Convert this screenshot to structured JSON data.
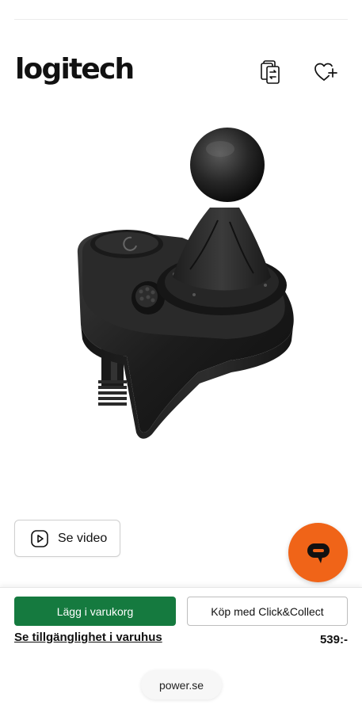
{
  "header": {
    "brand": "logitech",
    "compare_icon": "compare-cards-icon",
    "wishlist_icon": "heart-plus-icon"
  },
  "product": {
    "image_icon": "gear-shifter-image"
  },
  "video": {
    "label": "Se video",
    "icon": "play-icon"
  },
  "chat": {
    "icon": "chat-bubble-icon",
    "color": "#f06418"
  },
  "actions": {
    "add_to_cart": "Lägg i varukorg",
    "click_collect": "Köp med Click&Collect",
    "availability_link": "Se tillgänglighet i varuhus",
    "price": "539:-"
  },
  "browser": {
    "url": "power.se"
  },
  "colors": {
    "primary_green": "#157a3f",
    "accent_orange": "#f06418"
  }
}
